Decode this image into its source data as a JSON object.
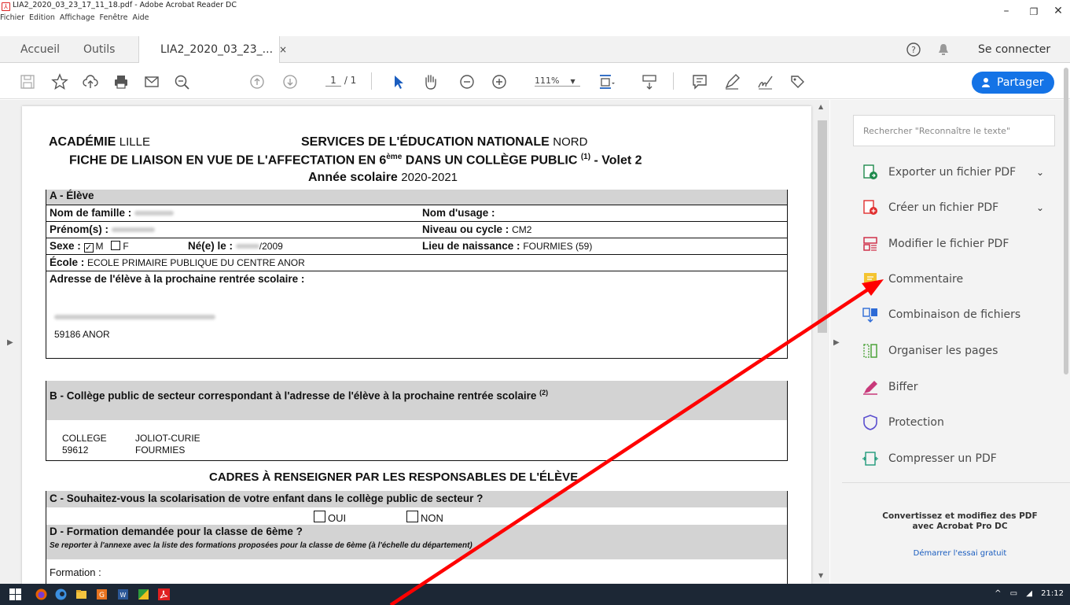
{
  "window": {
    "title": "LIA2_2020_03_23_17_11_18.pdf - Adobe Acrobat Reader DC",
    "menus": [
      "Fichier",
      "Edition",
      "Affichage",
      "Fenêtre",
      "Aide"
    ]
  },
  "tabs": {
    "home": "Accueil",
    "tools": "Outils",
    "doc": "LIA2_2020_03_23_...",
    "close": "×",
    "signin": "Se connecter"
  },
  "toolbar": {
    "page_current": "1",
    "page_total": "/ 1",
    "zoom": "111%",
    "share": "Partager"
  },
  "right_panel": {
    "search_placeholder": "Rechercher \"Reconnaître le texte\"",
    "tools": [
      {
        "label": "Exporter un fichier PDF",
        "icon": "export-pdf-icon",
        "color": "#1e8a4c"
      },
      {
        "label": "Créer un fichier PDF",
        "icon": "create-pdf-icon",
        "color": "#e02e2e"
      },
      {
        "label": "Modifier le fichier PDF",
        "icon": "edit-pdf-icon",
        "color": "#d0314a"
      },
      {
        "label": "Commentaire",
        "icon": "comment-icon",
        "color": "#f4c430"
      },
      {
        "label": "Combinaison de fichiers",
        "icon": "combine-files-icon",
        "color": "#2d6bd6"
      },
      {
        "label": "Organiser les pages",
        "icon": "organize-pages-icon",
        "color": "#4da33a"
      },
      {
        "label": "Biffer",
        "icon": "redact-icon",
        "color": "#c8397a"
      },
      {
        "label": "Protection",
        "icon": "protect-icon",
        "color": "#5b4fcf"
      },
      {
        "label": "Compresser un PDF",
        "icon": "compress-pdf-icon",
        "color": "#1f9a7a"
      }
    ],
    "promo_line1": "Convertissez et modifiez des PDF",
    "promo_line2": "avec Acrobat Pro DC",
    "trial": "Démarrer l'essai gratuit"
  },
  "taskbar": {
    "time": "21:12"
  },
  "doc": {
    "academie_label": "ACADÉMIE",
    "academie_value": "LILLE",
    "services_label": "SERVICES DE L'ÉDUCATION NATIONALE",
    "services_value": "NORD",
    "title_main": "FICHE DE LIAISON EN VUE DE L'AFFECTATION EN 6",
    "title_sup": "ème",
    "title_rest": " DANS UN COLLÈGE PUBLIC ",
    "title_note": "(1)",
    "title_end": " - Volet 2",
    "year_label": "Année scolaire",
    "year_value": "2020-2021",
    "section_a": "A - Élève",
    "nom_famille": "Nom de famille :",
    "nom_usage": "Nom d'usage :",
    "prenom": "Prénom(s) :",
    "niveau": "Niveau ou cycle :",
    "niveau_value": "CM2",
    "sexe": "Sexe :",
    "sexe_m_check": "✓",
    "sexe_m": "M",
    "sexe_f": "F",
    "ne_le": "Né(e) le :",
    "ne_le_value": "/2009",
    "lieu": "Lieu de naissance :",
    "lieu_value": "FOURMIES (59)",
    "ecole": "École :",
    "ecole_value": "ECOLE PRIMAIRE PUBLIQUE DU CENTRE  ANOR",
    "adresse": "Adresse de l'élève à la prochaine rentrée scolaire :",
    "adresse_cp": "59186   ANOR",
    "section_b": "B - Collège public de secteur correspondant à l'adresse de l'élève à la prochaine rentrée scolaire",
    "section_b_note": "(2)",
    "college_type": "COLLEGE",
    "college_name": "JOLIOT-CURIE",
    "college_cp": "59612",
    "college_city": "FOURMIES",
    "cadres": "CADRES À RENSEIGNER PAR LES RESPONSABLES DE L'ÉLÈVE",
    "section_c": "C - Souhaitez-vous la scolarisation de votre enfant dans le collège public de secteur ?",
    "oui": "OUI",
    "non": "NON",
    "section_d": "D - Formation demandée pour la classe de 6ème ?",
    "section_d_note": "Se reporter à l'annexe avec la liste des formations proposées pour la classe de 6ème (à l'échelle du département)",
    "formation": "Formation :"
  }
}
